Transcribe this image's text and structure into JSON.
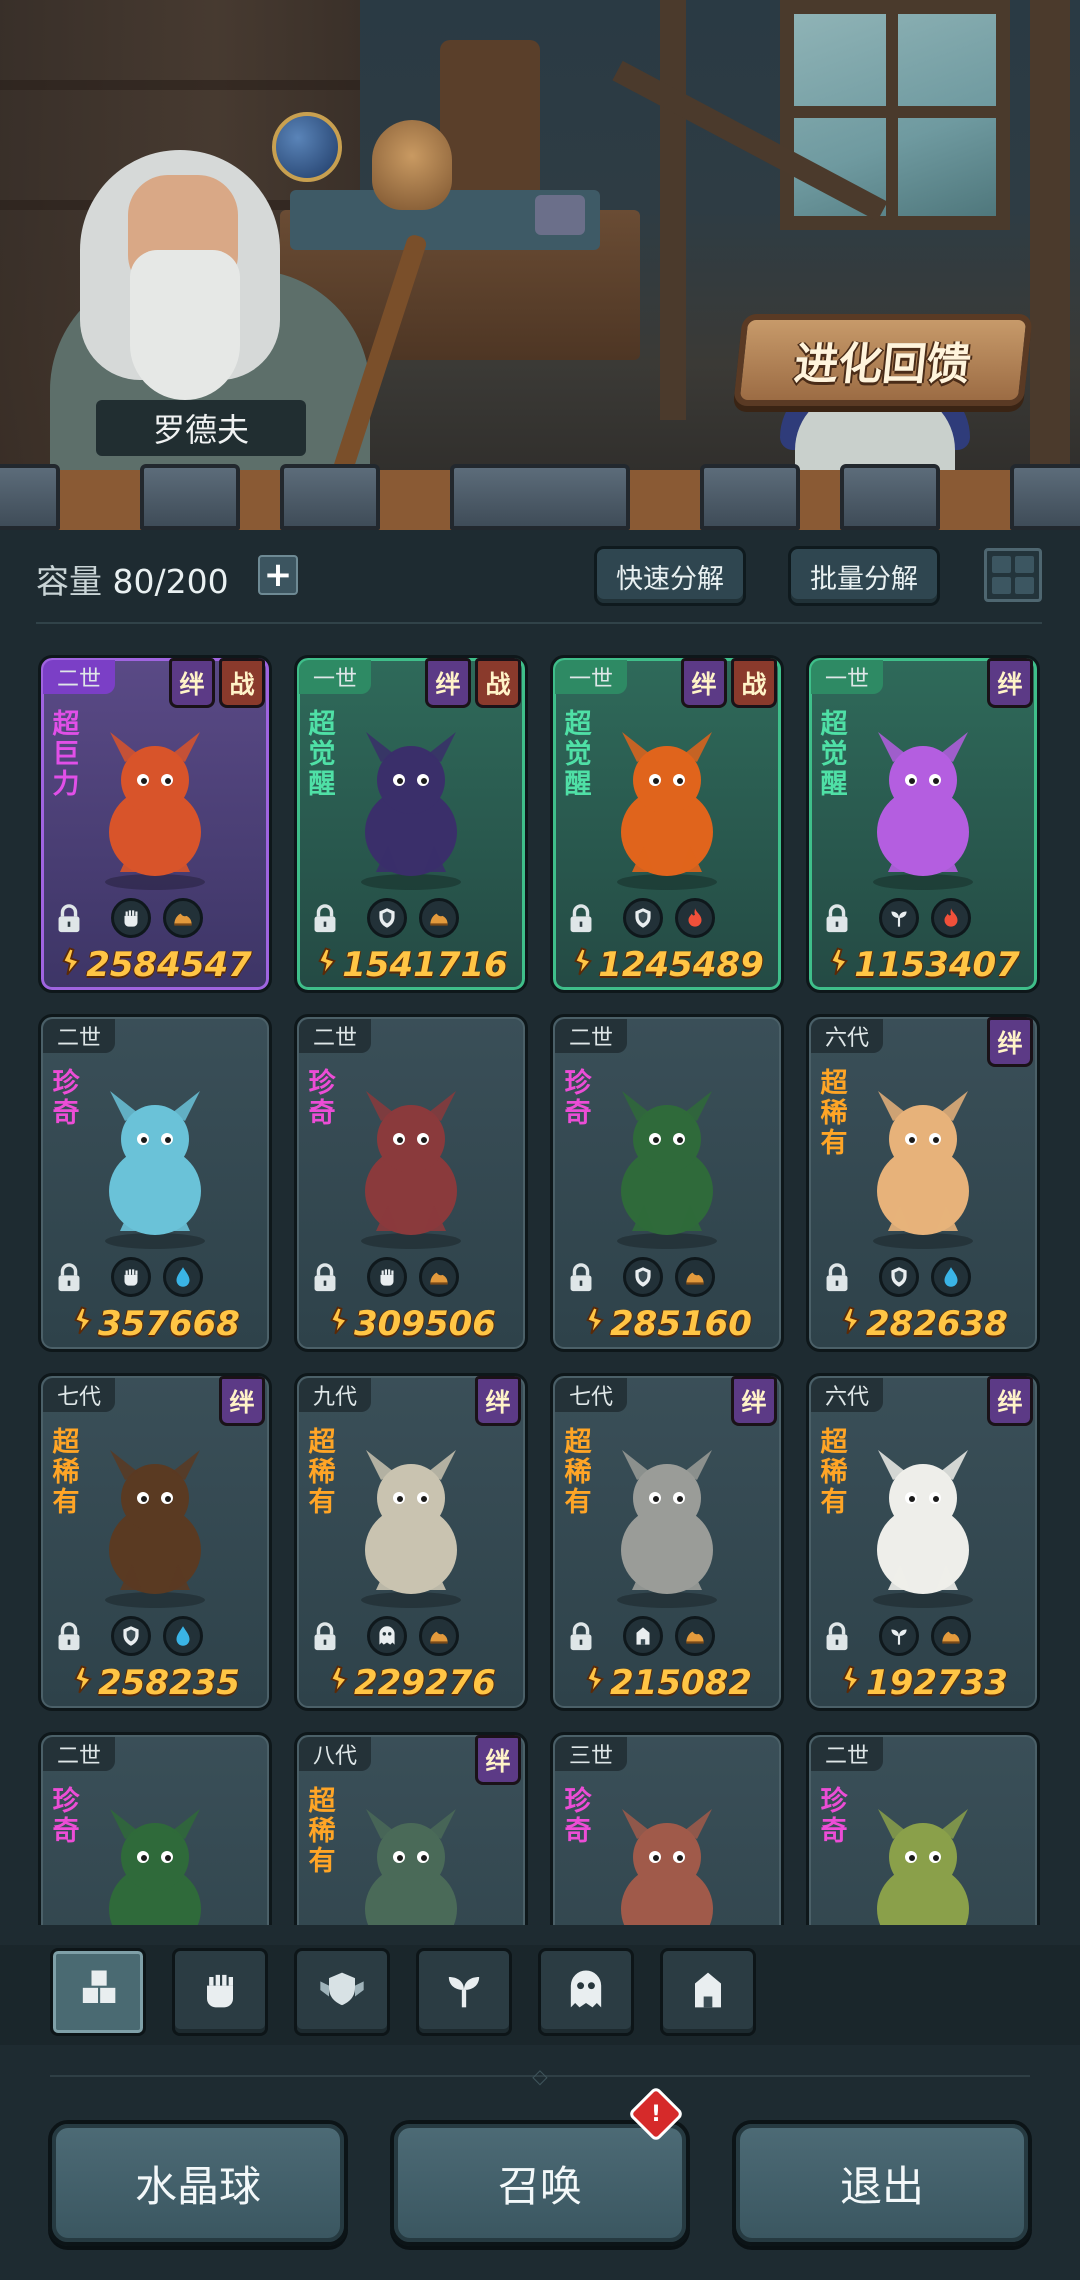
{
  "scene": {
    "npc_name": "罗德夫",
    "evolution_button": "进化回馈"
  },
  "toolbar": {
    "capacity_label": "容量",
    "capacity_value": "80/200",
    "add_label": "+",
    "quick_decompose": "快速分解",
    "batch_decompose": "批量分解"
  },
  "cards": [
    {
      "gen": "二世",
      "rarity": "超巨力",
      "rarity_color": "purple",
      "frame": "purple",
      "tags": [
        "绊",
        "战"
      ],
      "power": "2584547",
      "badges": [
        "fist-icon",
        "earth-icon"
      ],
      "body_color": "#d8542a"
    },
    {
      "gen": "一世",
      "rarity": "超觉醒",
      "rarity_color": "green",
      "frame": "green",
      "tags": [
        "绊",
        "战"
      ],
      "power": "1541716",
      "badges": [
        "shield-icon",
        "earth-icon"
      ],
      "body_color": "#3a2f6a"
    },
    {
      "gen": "一世",
      "rarity": "超觉醒",
      "rarity_color": "green",
      "frame": "green",
      "tags": [
        "绊",
        "战"
      ],
      "power": "1245489",
      "badges": [
        "shield-icon",
        "fire-icon"
      ],
      "body_color": "#e0641c"
    },
    {
      "gen": "一世",
      "rarity": "超觉醒",
      "rarity_color": "green",
      "frame": "green",
      "tags": [
        "绊"
      ],
      "power": "1153407",
      "badges": [
        "sprout-icon",
        "fire-icon"
      ],
      "body_color": "#b45ee0"
    },
    {
      "gen": "二世",
      "rarity": "珍奇",
      "rarity_color": "pink",
      "frame": "plain",
      "tags": [],
      "power": "357668",
      "badges": [
        "fist-icon",
        "water-icon"
      ],
      "body_color": "#6ac2d8"
    },
    {
      "gen": "二世",
      "rarity": "珍奇",
      "rarity_color": "pink",
      "frame": "plain",
      "tags": [],
      "power": "309506",
      "badges": [
        "fist-icon",
        "earth-icon"
      ],
      "body_color": "#8a3a3c"
    },
    {
      "gen": "二世",
      "rarity": "珍奇",
      "rarity_color": "pink",
      "frame": "plain",
      "tags": [],
      "power": "285160",
      "badges": [
        "shield-icon",
        "earth-icon"
      ],
      "body_color": "#2f6a3a"
    },
    {
      "gen": "六代",
      "rarity": "超稀有",
      "rarity_color": "orange",
      "frame": "plain",
      "tags": [
        "绊"
      ],
      "power": "282638",
      "badges": [
        "shield-icon",
        "water-icon"
      ],
      "body_color": "#e7b27a"
    },
    {
      "gen": "七代",
      "rarity": "超稀有",
      "rarity_color": "orange",
      "frame": "plain",
      "tags": [
        "绊"
      ],
      "power": "258235",
      "badges": [
        "shield-icon",
        "water-icon"
      ],
      "body_color": "#5a3a22"
    },
    {
      "gen": "九代",
      "rarity": "超稀有",
      "rarity_color": "orange",
      "frame": "plain",
      "tags": [
        "绊"
      ],
      "power": "229276",
      "badges": [
        "ghost-icon",
        "earth-icon"
      ],
      "body_color": "#c9c3b0"
    },
    {
      "gen": "七代",
      "rarity": "超稀有",
      "rarity_color": "orange",
      "frame": "plain",
      "tags": [
        "绊"
      ],
      "power": "215082",
      "badges": [
        "tower-icon",
        "earth-icon"
      ],
      "body_color": "#9a9c98"
    },
    {
      "gen": "六代",
      "rarity": "超稀有",
      "rarity_color": "orange",
      "frame": "plain",
      "tags": [
        "绊"
      ],
      "power": "192733",
      "badges": [
        "sprout-icon",
        "earth-icon"
      ],
      "body_color": "#eeeeea"
    },
    {
      "gen": "二世",
      "rarity": "珍奇",
      "rarity_color": "pink",
      "frame": "plain",
      "tags": [],
      "power": "",
      "badges": [],
      "body_color": "#2f6a3a"
    },
    {
      "gen": "八代",
      "rarity": "超稀有",
      "rarity_color": "orange",
      "frame": "plain",
      "tags": [
        "绊"
      ],
      "power": "",
      "badges": [],
      "body_color": "#4a6a58"
    },
    {
      "gen": "三世",
      "rarity": "珍奇",
      "rarity_color": "pink",
      "frame": "plain",
      "tags": [],
      "power": "",
      "badges": [],
      "body_color": "#a05a4a"
    },
    {
      "gen": "二世",
      "rarity": "珍奇",
      "rarity_color": "pink",
      "frame": "plain",
      "tags": [],
      "power": "",
      "badges": [],
      "body_color": "#8aa04a"
    }
  ],
  "filters": [
    "all-icon",
    "fist-icon",
    "shield-wing-icon",
    "sprout-icon",
    "ghost-icon",
    "tower-icon"
  ],
  "buttons": {
    "crystal_ball": "水晶球",
    "summon": "召唤",
    "summon_alert": "!",
    "exit": "退出"
  },
  "colors": {
    "power_gold": "#ffc545",
    "rarity_pink": "#ec4dd6",
    "rarity_orange": "#ffa526",
    "rarity_green": "#4fe0a6",
    "rarity_purple": "#e14fe8",
    "tag_bond": "#5c3a86",
    "tag_war": "#8a3a2c"
  }
}
